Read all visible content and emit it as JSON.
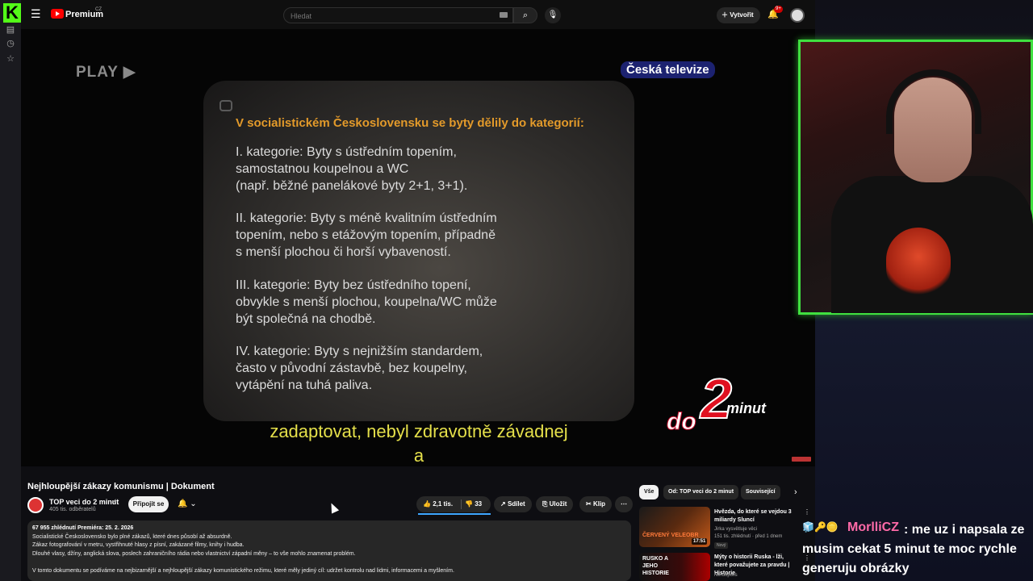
{
  "rail": {
    "logo": "K",
    "icons": [
      "clipboard-icon",
      "clock-icon",
      "star-icon"
    ]
  },
  "topbar": {
    "brand": "Premium",
    "region": "CZ",
    "search_placeholder": "Hledat",
    "create_label": "Vytvořit",
    "notification_count": "9+"
  },
  "video": {
    "overlay_play": "PLAY ▶",
    "tv_logo": "Česká televize",
    "slide": {
      "heading": "V socialistickém Československu se byty dělily do kategorií:",
      "categories": [
        [
          "I. kategorie: Byty s ústředním topením,",
          "samostatnou koupelnou a WC",
          "(např. běžné panelákové byty 2+1, 3+1)."
        ],
        [
          "II. kategorie: Byty s méně kvalitním ústředním",
          "topením, nebo s etážovým topením, případně",
          "s menší plochou či horší vybaveností."
        ],
        [
          "III. kategorie: Byty bez ústředního topení,",
          "obvykle s menší plochou, koupelna/WC může",
          "být společná na chodbě."
        ],
        [
          "IV. kategorie: Byty s nejnižším standardem,",
          "často v původní zástavbě, bez koupelny,",
          "vytápění na tuhá paliva."
        ]
      ]
    },
    "subtitles": [
      "zadaptovat, nebyl zdravotně závadnej",
      "a"
    ],
    "channel_logo": {
      "do": "do",
      "number": "2",
      "minut": "minut"
    }
  },
  "details": {
    "title": "Nejhloupější zákazy komunismu | Dokument",
    "channel_name": "TOP veci do 2 minut",
    "subscribers": "405 tis. odběratelů",
    "subscribe_label": "Připojit se",
    "likes": "2,1 tis.",
    "dislikes": "33",
    "share_label": "Sdílet",
    "save_label": "Uložit",
    "clip_label": "Klip",
    "description": {
      "stats": "67 955 zhlédnutí  Premiéra: 25. 2. 2026",
      "lines": [
        "Socialistické Československo bylo plné zákazů, které dnes působí až absurdně.",
        "Zákaz fotografování v metru, vystřihnuté hlasy z písní, zakázané filmy, knihy i hudba.",
        "Dlouhé vlasy, džíny, anglická slova, poslech zahraničního rádia nebo vlastnictví západní měny – to vše mohlo znamenat problém.",
        "",
        "V tomto dokumentu se podíváme na nejbizarnější a nejhloupější zákazy komunistického režimu, které měly jediný cíl: udržet kontrolu nad lidmi, informacemi a myšlením."
      ]
    }
  },
  "related": {
    "chips": [
      "Vše",
      "Od: TOP veci do 2 minut",
      "Související"
    ],
    "items": [
      {
        "thumb_text": "ČERVENÝ VELEOBR",
        "duration": "17:51",
        "title": "Hvězda, do které se vejdou 3 miliardy Sluncí",
        "channel": "Jirka vysvětluje věci",
        "meta": "151 tis. zhlédnutí · před 1 dnem",
        "badge": "Nový"
      },
      {
        "thumb_text": "RUSKO A JEHO HISTORIE",
        "title": "Mýty o historii Ruska - lži, které považujete za pravdu | Historie",
        "channel": "Nerdopolis"
      }
    ]
  },
  "stream": {
    "chat": {
      "username": "MorlliCZ",
      "message": ": me uz i napsala ze musim cekat 5 minut te moc rychle generuju obrázky"
    }
  },
  "colors": {
    "kick_green": "#53fc18",
    "yt_red": "#ff0000",
    "slide_heading": "#e39a2a",
    "subtitle_yellow": "#e5e04a",
    "webcam_border": "#40e040",
    "chat_user": "#ff6aa8"
  }
}
